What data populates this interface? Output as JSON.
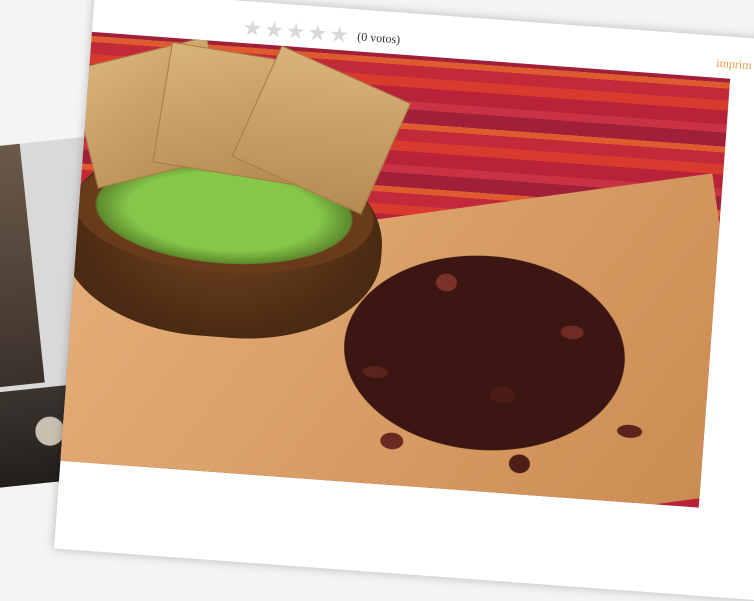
{
  "rating": {
    "stars": "★★★★★",
    "votes_text": "(0 votos)"
  },
  "actions": {
    "print": "imprim"
  },
  "photo": {
    "subject": "chapulines-and-guacamole"
  },
  "colors": {
    "accent": "#e0a04a",
    "textile_red": "#c22a3a"
  }
}
